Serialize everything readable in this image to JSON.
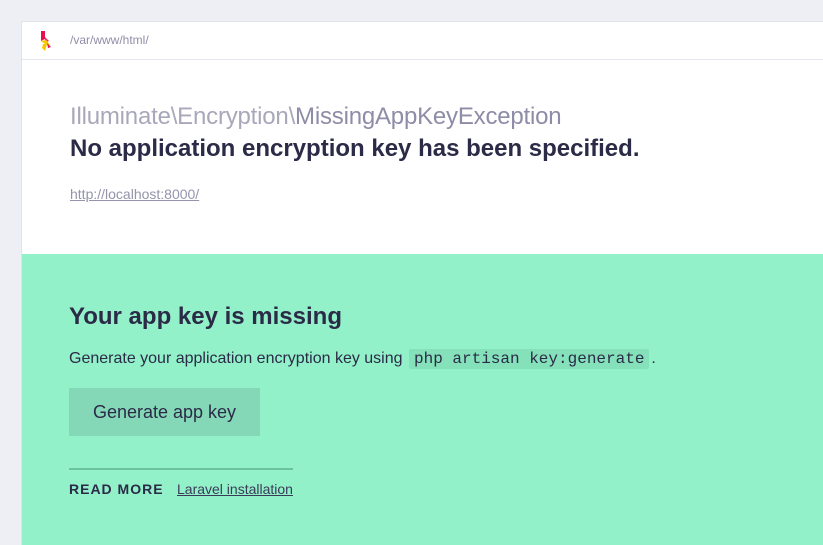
{
  "header": {
    "path": "/var/www/html/",
    "logo_icon": "ignition-flame-logo"
  },
  "exception": {
    "namespace": "Illuminate\\Encryption\\",
    "class_name": "MissingAppKeyException",
    "message": "No application encryption key has been specified.",
    "url": "http://localhost:8000/"
  },
  "solution": {
    "title": "Your app key is missing",
    "description_prefix": "Generate your application encryption key using",
    "command": "php artisan key:generate",
    "description_suffix": ".",
    "button_label": "Generate app key",
    "read_more_label": "READ MORE",
    "link_label": "Laravel installation"
  },
  "colors": {
    "solution_bg": "#92f1c9",
    "page_bg": "#eeeff4",
    "text_dark": "#2b2a47",
    "logo_red": "#e8104c",
    "logo_yellow": "#f5c800"
  }
}
